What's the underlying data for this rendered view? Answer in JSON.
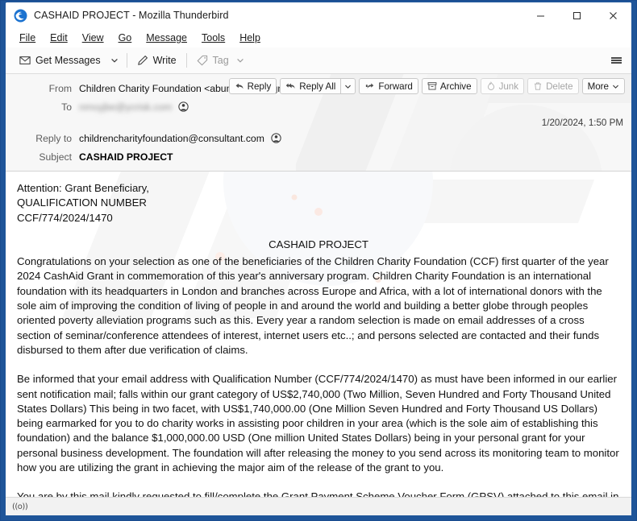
{
  "window": {
    "title": "CASHAID PROJECT - Mozilla Thunderbird",
    "logo_icon": "thunderbird-logo-icon",
    "controls": {
      "minimize": "minimize-icon",
      "maximize": "maximize-icon",
      "close": "close-icon"
    }
  },
  "menubar": {
    "items": [
      {
        "label": "File",
        "accel": "F"
      },
      {
        "label": "Edit",
        "accel": "E"
      },
      {
        "label": "View",
        "accel": "V"
      },
      {
        "label": "Go",
        "accel": "G"
      },
      {
        "label": "Message",
        "accel": "M"
      },
      {
        "label": "Tools",
        "accel": "T"
      },
      {
        "label": "Help",
        "accel": "H"
      }
    ]
  },
  "toolbar": {
    "get_messages_label": "Get Messages",
    "get_messages_icon": "envelope-download-icon",
    "get_messages_dropdown_icon": "chevron-down-icon",
    "write_label": "Write",
    "write_icon": "pencil-icon",
    "tag_label": "Tag",
    "tag_icon": "tag-icon",
    "tag_dropdown_icon": "chevron-down-icon",
    "app_menu_icon": "hamburger-menu-icon"
  },
  "header": {
    "from_label": "From",
    "from_value": "Children Charity Foundation <abumskyjoe@gmail.com>",
    "from_contact_icon": "contact-circle-icon",
    "to_label": "To",
    "to_value": "nmvyjbe@ycrisk.com",
    "to_redacted": true,
    "to_contact_icon": "contact-circle-icon",
    "reply_to_label": "Reply to",
    "reply_to_value": "childrencharityfoundation@consultant.com",
    "reply_to_contact_icon": "contact-circle-icon",
    "subject_label": "Subject",
    "subject_value": "CASHAID PROJECT",
    "date": "1/20/2024, 1:50 PM",
    "actions": [
      {
        "label": "Reply",
        "icon": "reply-arrow-icon",
        "disabled": false,
        "has_dropdown": false
      },
      {
        "label": "Reply All",
        "icon": "reply-all-arrow-icon",
        "disabled": false,
        "has_dropdown": true
      },
      {
        "label": "Forward",
        "icon": "forward-arrow-icon",
        "disabled": false,
        "has_dropdown": false
      },
      {
        "label": "Archive",
        "icon": "archive-box-icon",
        "disabled": false,
        "has_dropdown": false
      },
      {
        "label": "Junk",
        "icon": "junk-flame-icon",
        "disabled": true,
        "has_dropdown": false
      },
      {
        "label": "Delete",
        "icon": "trash-icon",
        "disabled": true,
        "has_dropdown": false
      },
      {
        "label": "More",
        "icon": "chevron-down-icon",
        "disabled": false,
        "has_dropdown": true
      }
    ],
    "dropdown_icon": "chevron-down-icon"
  },
  "message": {
    "attention_line": "Attention: Grant Beneficiary,",
    "qualification_label": "QUALIFICATION NUMBER",
    "qualification_number": "CCF/774/2024/1470",
    "centered_title": "CASHAID PROJECT",
    "paragraph_1": "Congratulations on your selection as one of the beneficiaries of the Children Charity Foundation (CCF) first quarter of the year 2024 CashAid Grant in commemoration of this year's anniversary program. Children Charity Foundation is an international foundation with its headquarters in London and branches across Europe and Africa, with a lot of international donors with the sole aim of improving the condition of living of people in and around the world and building a better globe through peoples oriented poverty alleviation programs such as this. Every year a random selection is made on email addresses of a cross section of seminar/conference attendees of interest, internet users etc..; and persons selected are contacted and their funds disbursed to them after due verification of claims.",
    "paragraph_2": "Be informed that your email address with Qualification Number (CCF/774/2024/1470) as must have been informed in our earlier sent notification mail; falls within our grant category of US$2,740,000 (Two Million, Seven Hundred and Forty Thousand United States Dollars) This being in two facet, with US$1,740,000.00 (One Million Seven Hundred and Forty Thousand US Dollars) being earmarked for you to do charity works in assisting poor children in your area (which is the sole aim of establishing this foundation) and the balance $1,000,000.00 USD (One million United States Dollars) being in your personal grant for your personal business development. The foundation will after releasing the money to you send across its monitoring team to monitor how you are utilizing the grant in achieving the major aim of the release of the grant to you.",
    "paragraph_3": "You are by this mail kindly requested to fill/complete the Grant Payment Scheme Voucher Form (GPSV) attached to this email in PDF format to aid in the processing of your grant release."
  },
  "statusbar": {
    "icon": "broadcast-signal-icon",
    "icon_glyph": "((o))"
  },
  "colors": {
    "window_frame": "#1f5599",
    "titlebar_bg": "#ffffff",
    "toolbar_bg": "#fbfbfb",
    "header_bg": "#f7f7f7",
    "body_bg": "#ffffff",
    "statusbar_bg": "#f2f2f2",
    "text": "#111111",
    "label_text": "#5d5d5d",
    "disabled_text": "#a6a6a6"
  }
}
